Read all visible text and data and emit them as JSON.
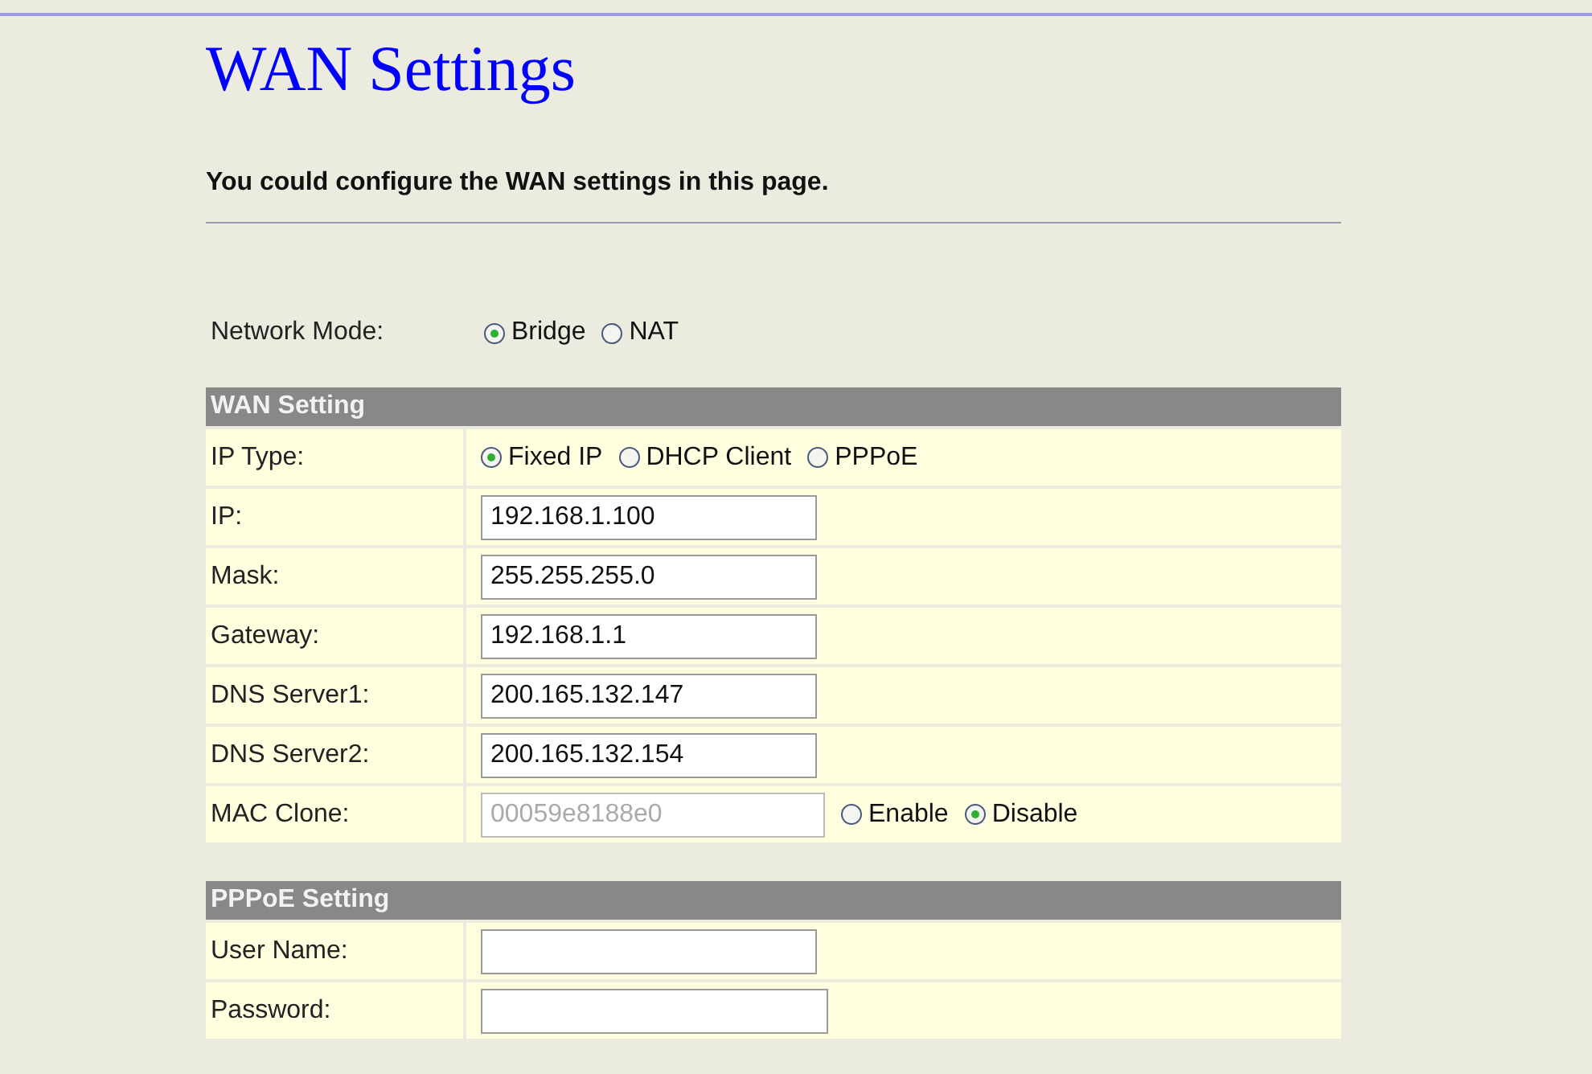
{
  "title": "WAN Settings",
  "subtitle": "You could configure the WAN settings in this page.",
  "network_mode": {
    "label": "Network Mode:",
    "options": [
      {
        "label": "Bridge",
        "selected": true
      },
      {
        "label": "NAT",
        "selected": false
      }
    ]
  },
  "sections": [
    {
      "heading": "WAN Setting",
      "rows": [
        {
          "kind": "radios",
          "label": "IP Type:",
          "options": [
            {
              "label": "Fixed IP",
              "selected": true
            },
            {
              "label": "DHCP Client",
              "selected": false
            },
            {
              "label": "PPPoE",
              "selected": false
            }
          ]
        },
        {
          "kind": "input",
          "label": "IP:",
          "value": "192.168.1.100"
        },
        {
          "kind": "input",
          "label": "Mask:",
          "value": "255.255.255.0"
        },
        {
          "kind": "input",
          "label": "Gateway:",
          "value": "192.168.1.1"
        },
        {
          "kind": "input",
          "label": "DNS Server1:",
          "value": "200.165.132.147"
        },
        {
          "kind": "input",
          "label": "DNS Server2:",
          "value": "200.165.132.154"
        },
        {
          "kind": "mac",
          "label": "MAC Clone:",
          "value": "00059e8188e0",
          "disabled": true,
          "options": [
            {
              "label": "Enable",
              "selected": false
            },
            {
              "label": "Disable",
              "selected": true
            }
          ]
        }
      ]
    },
    {
      "heading": "PPPoE Setting",
      "rows": [
        {
          "kind": "input",
          "label": "User Name:"
        },
        {
          "kind": "password",
          "label": "Password:"
        }
      ]
    }
  ]
}
